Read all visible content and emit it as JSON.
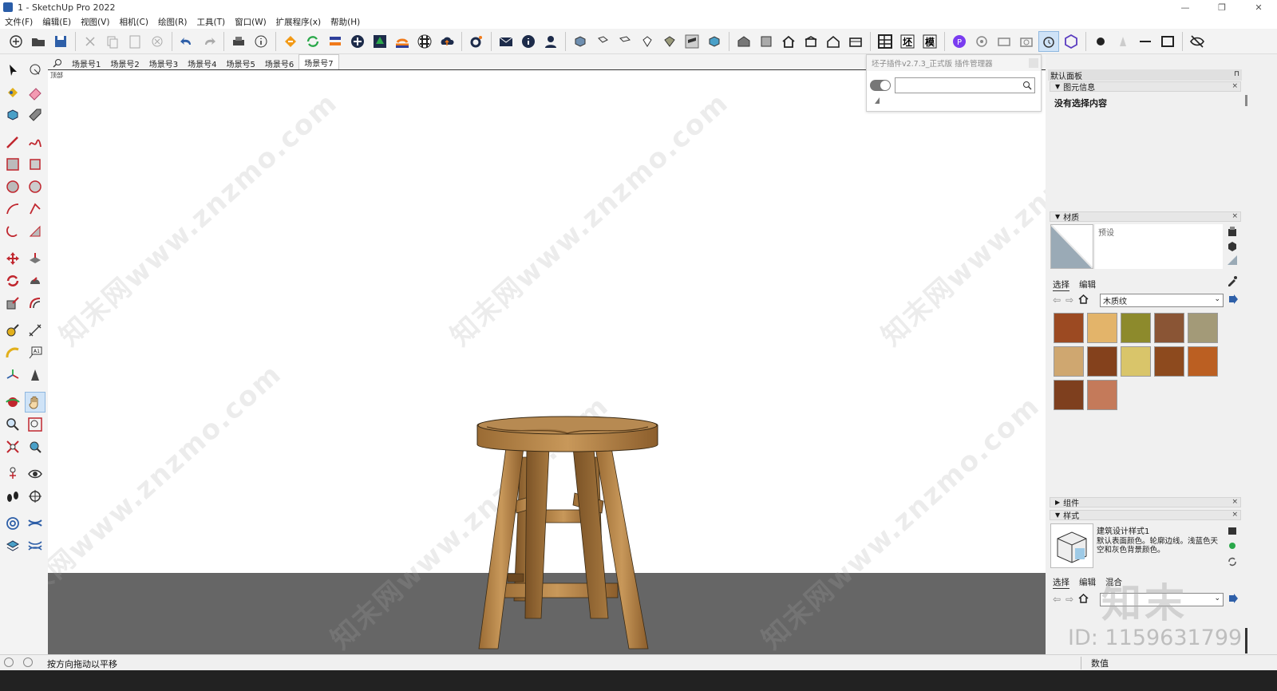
{
  "window": {
    "title": "1 - SketchUp Pro 2022",
    "controls": [
      "—",
      "❐",
      "✕"
    ]
  },
  "menu": [
    "文件(F)",
    "编辑(E)",
    "视图(V)",
    "相机(C)",
    "绘图(R)",
    "工具(T)",
    "窗口(W)",
    "扩展程序(x)",
    "帮助(H)"
  ],
  "scene_tabs": {
    "search_icon": "search-icon",
    "tabs": [
      "场景号1",
      "场景号2",
      "场景号3",
      "场景号4",
      "场景号5",
      "场景号6",
      "场景号7"
    ],
    "active_index": 6
  },
  "viewport": {
    "label": "顶部",
    "watermark_text": "知末网www.znzmo.com",
    "model": "stool"
  },
  "plugin_manager": {
    "title": "坯子插件v2.7.3_正式版 插件管理器",
    "search_value": ""
  },
  "tray": {
    "title": "默认面板",
    "entity_info": {
      "header": "图元信息",
      "content": "没有选择内容"
    },
    "materials": {
      "header": "材质",
      "name_value": "预设",
      "tabs": [
        "选择",
        "编辑"
      ],
      "library": "木质纹",
      "swatch_colors": [
        "#9c4a22",
        "#e3b46a",
        "#8d8a2c",
        "#8a5535",
        "#a39a78",
        "#cfa770",
        "#84411c",
        "#d9c56a",
        "#8d4a1e",
        "#bb5f22",
        "#7e3f1e",
        "#c47a5a"
      ]
    },
    "components": {
      "header": "组件"
    },
    "styles": {
      "header": "样式",
      "style_name": "建筑设计样式1",
      "style_desc": "默认表面颜色。轮廓边线。浅蓝色天空和灰色背景颜色。",
      "tabs": [
        "选择",
        "编辑",
        "混合"
      ]
    }
  },
  "status": {
    "hint": "按方向拖动以平移",
    "measure_label": "数值"
  },
  "overlay": {
    "logo": "知末",
    "id_text": "ID: 1159631799"
  }
}
